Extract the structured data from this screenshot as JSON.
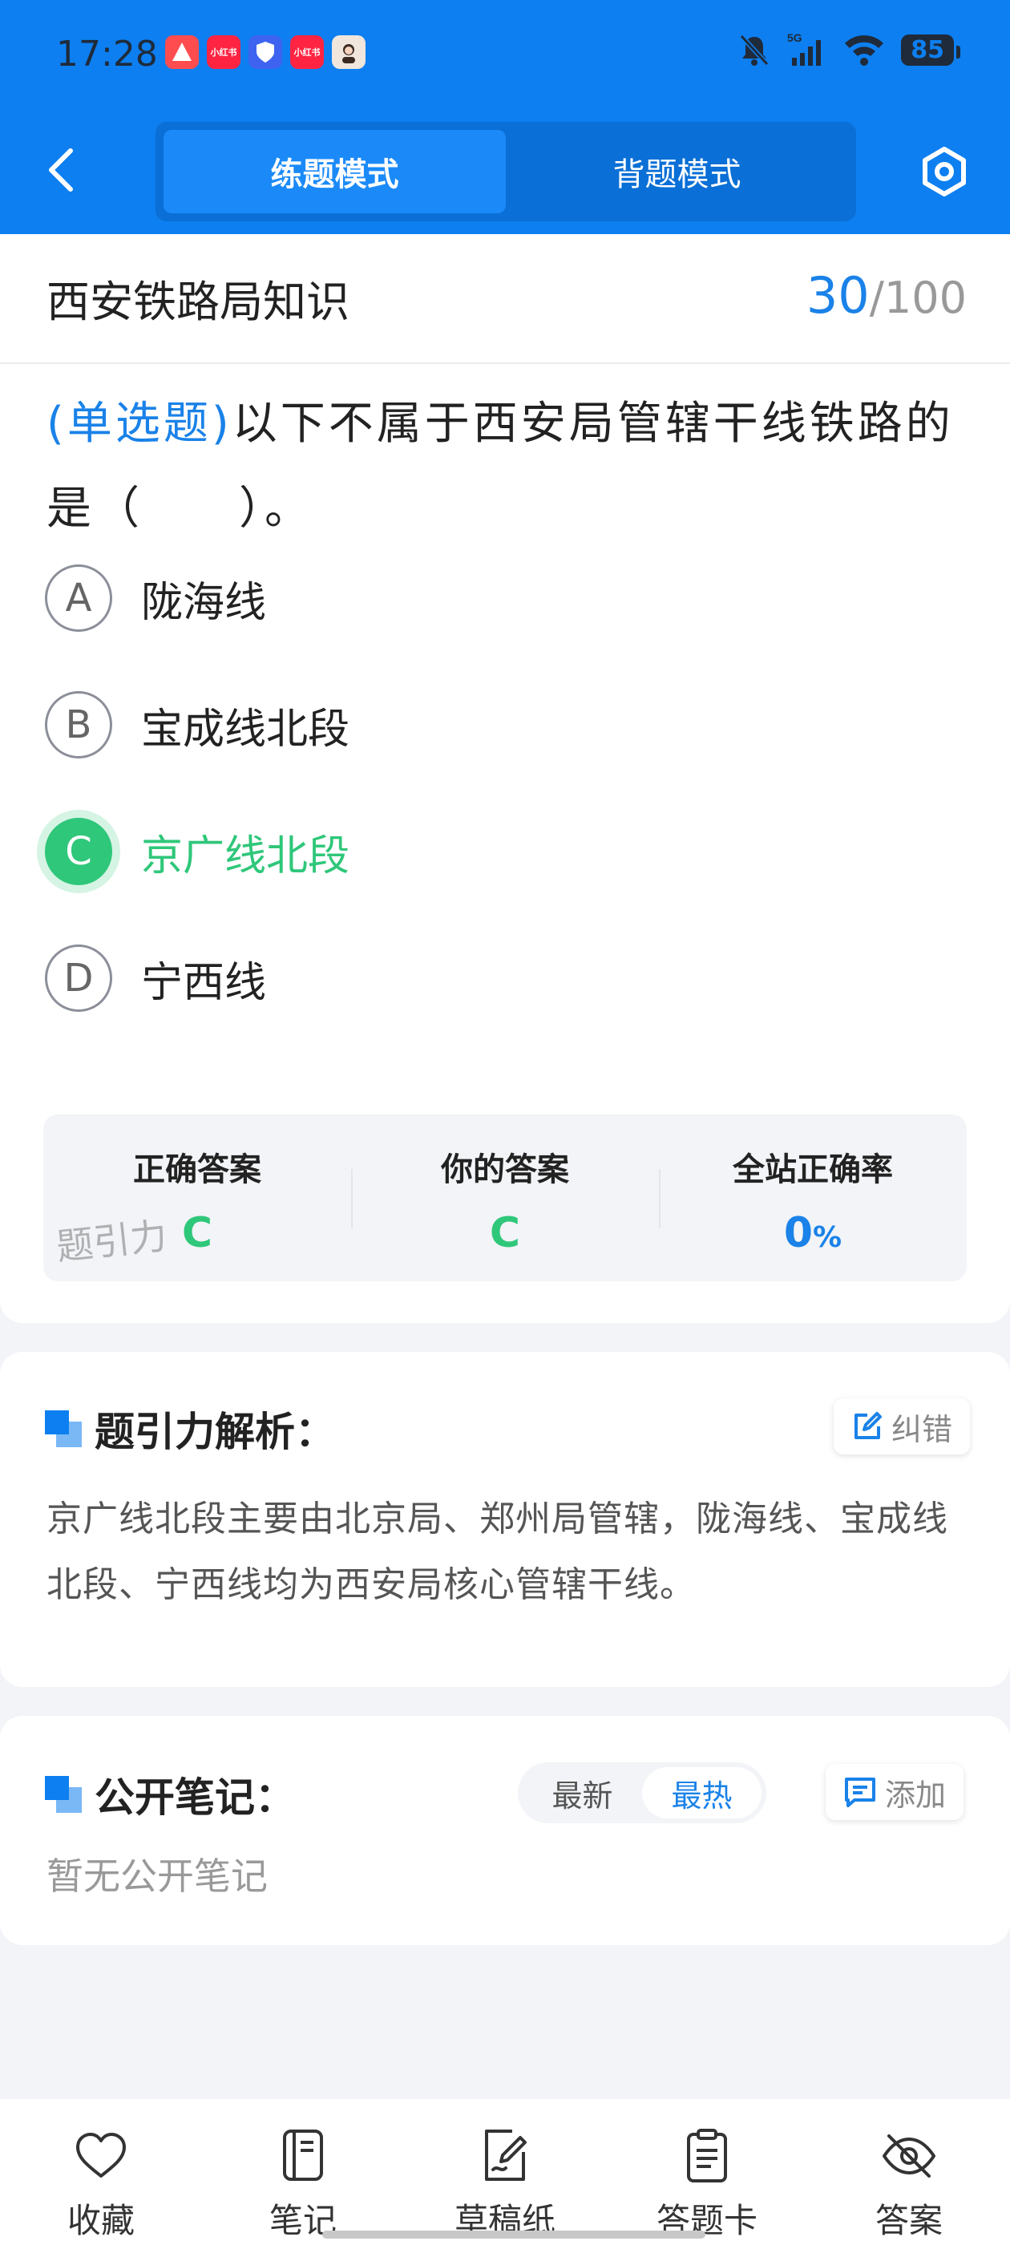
{
  "status_bar": {
    "time": "17:28",
    "battery": "85",
    "network": "5G",
    "notif_labels": [
      "",
      "小红书",
      "",
      "小红书",
      ""
    ]
  },
  "header": {
    "tabs": [
      {
        "label": "练题模式",
        "active": true
      },
      {
        "label": "背题模式",
        "active": false
      }
    ]
  },
  "bank": {
    "title": "西安铁路局知识",
    "current": "30",
    "total": "/100"
  },
  "question": {
    "type": "(单选题)",
    "text": "以下不属于西安局管辖干线铁路的是（　　）。",
    "options": [
      {
        "letter": "A",
        "text": "陇海线",
        "selected": false
      },
      {
        "letter": "B",
        "text": "宝成线北段",
        "selected": false
      },
      {
        "letter": "C",
        "text": "京广线北段",
        "selected": true
      },
      {
        "letter": "D",
        "text": "宁西线",
        "selected": false
      }
    ]
  },
  "answer_summary": {
    "correct_label": "正确答案",
    "correct_value": "C",
    "yours_label": "你的答案",
    "yours_value": "C",
    "rate_label": "全站正确率",
    "rate_value": "0",
    "rate_unit": "%",
    "watermark": "题引力"
  },
  "analysis": {
    "title": "题引力解析：",
    "correct_button": "纠错",
    "text": "京广线北段主要由北京局、郑州局管辖，陇海线、宝成线北段、宁西线均为西安局核心管辖干线。"
  },
  "notes": {
    "title": "公开笔记：",
    "sort_options": [
      "最新",
      "最热"
    ],
    "active_sort": "最热",
    "add_button": "添加",
    "empty_text": "暂无公开笔记"
  },
  "bottom_nav": [
    {
      "label": "收藏",
      "icon": "heart-icon"
    },
    {
      "label": "笔记",
      "icon": "notebook-icon"
    },
    {
      "label": "草稿纸",
      "icon": "draft-paper-icon"
    },
    {
      "label": "答题卡",
      "icon": "answer-card-icon"
    },
    {
      "label": "答案",
      "icon": "eye-off-icon"
    }
  ],
  "colors": {
    "brand_blue": "#0d7ff0",
    "correct_green": "#2fc77a",
    "accent_blue": "#1a82e8"
  }
}
